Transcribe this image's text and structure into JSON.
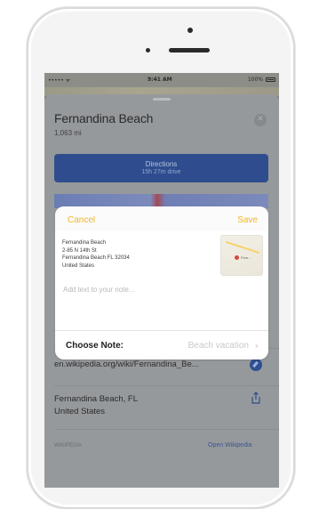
{
  "device": {
    "statusbar": {
      "carrier": "••••• ᯤ",
      "time": "9:41 AM",
      "battery": "100%"
    }
  },
  "place": {
    "title": "Fernandina Beach",
    "distance": "1,063 mi",
    "close_icon": "close-icon",
    "directions": {
      "label": "Directions",
      "subtitle": "15h 27m drive"
    },
    "wiki_url": "en.wikipedia.org/wiki/Fernandina_Be...",
    "address": {
      "line1": "Fernandina Beach, FL",
      "line2": "United States"
    },
    "section_label": "WIKIPEDIA",
    "open_wikipedia": "Open Wikipedia"
  },
  "note_sheet": {
    "cancel": "Cancel",
    "save": "Save",
    "address_lines": [
      "Fernandina Beach",
      "2-85 N 14th St",
      "Fernandina Beach FL 32034",
      "United States"
    ],
    "map_label": "Fern...",
    "placeholder": "Add text to your note...",
    "choose_label": "Choose Note:",
    "choose_value": "Beach vacation",
    "chevron": "›"
  },
  "colors": {
    "accent_yellow": "#f0b528",
    "directions_blue": "#2f4d8e",
    "dimmed_background": "#96999c"
  }
}
